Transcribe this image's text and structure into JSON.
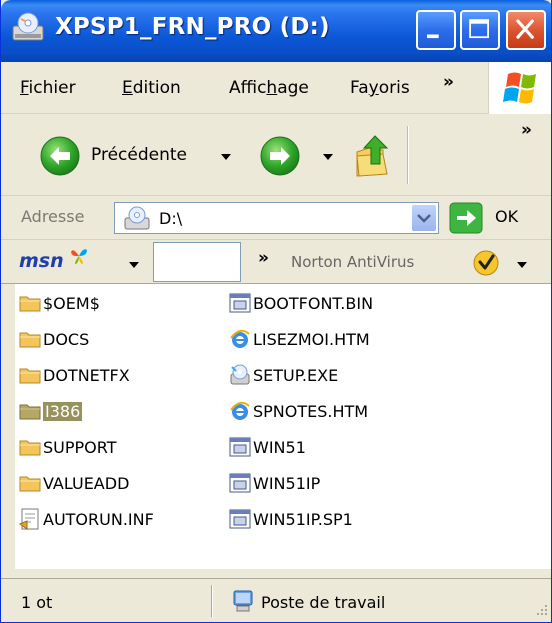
{
  "window": {
    "title": "XPSP1_FRN_PRO (D:)",
    "controls": {
      "minimize": "minimize",
      "maximize": "maximize",
      "close": "close"
    }
  },
  "menubar": {
    "items": [
      {
        "label": "Fichier",
        "mnemonic": "F"
      },
      {
        "label": "Edition",
        "mnemonic": "E"
      },
      {
        "label": "Affichage",
        "mnemonic": "h"
      },
      {
        "label": "Favoris",
        "mnemonic": "y"
      }
    ],
    "more": "»"
  },
  "toolbar": {
    "back_label": "Précédente",
    "more": "»"
  },
  "address": {
    "label": "Adresse",
    "value": "D:\\",
    "go_label": "OK"
  },
  "linksbar": {
    "msn": "msn",
    "more": "»",
    "norton": "Norton AntiVirus"
  },
  "files": {
    "column1": [
      {
        "name": "$OEM$",
        "type": "folder"
      },
      {
        "name": "DOCS",
        "type": "folder"
      },
      {
        "name": "DOTNETFX",
        "type": "folder"
      },
      {
        "name": "I386",
        "type": "folder",
        "selected": true
      },
      {
        "name": "SUPPORT",
        "type": "folder"
      },
      {
        "name": "VALUEADD",
        "type": "folder"
      },
      {
        "name": "AUTORUN.INF",
        "type": "inf"
      }
    ],
    "column2": [
      {
        "name": "BOOTFONT.BIN",
        "type": "bin"
      },
      {
        "name": "LISEZMOI.HTM",
        "type": "htm"
      },
      {
        "name": "SETUP.EXE",
        "type": "exe"
      },
      {
        "name": "SPNOTES.HTM",
        "type": "htm"
      },
      {
        "name": "WIN51",
        "type": "bin"
      },
      {
        "name": "WIN51IP",
        "type": "bin"
      },
      {
        "name": "WIN51IP.SP1",
        "type": "bin"
      }
    ]
  },
  "statusbar": {
    "left": "1 ot",
    "right": "Poste de travail"
  },
  "colors": {
    "titlebar": "#0b57d6",
    "chrome": "#ece9d8",
    "selection": "#97915b",
    "folder": "#f3c55a"
  }
}
